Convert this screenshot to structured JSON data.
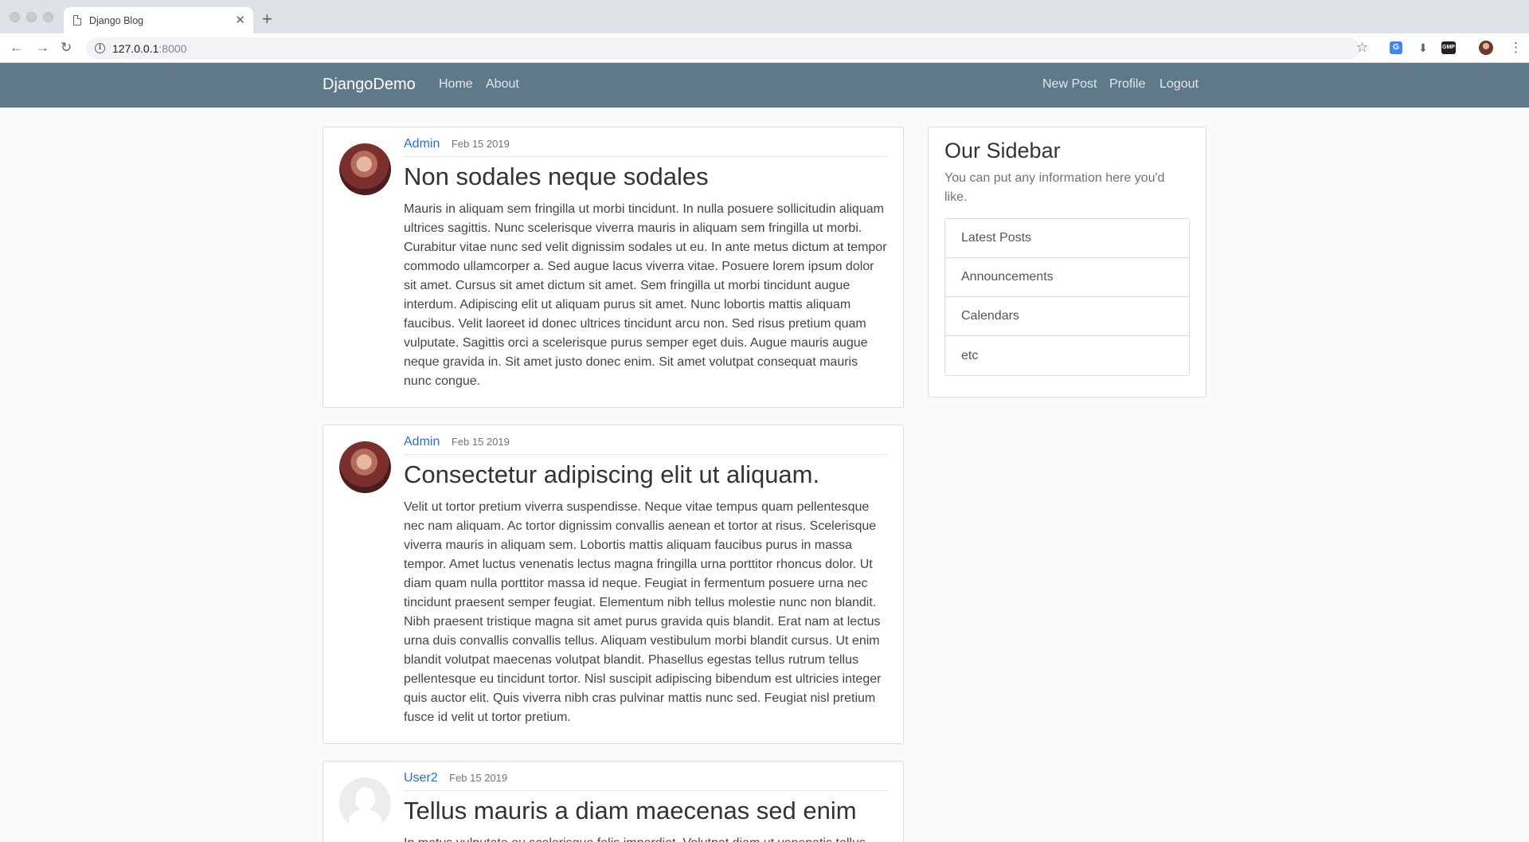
{
  "browser": {
    "tab_title": "Django Blog",
    "url_host": "127.0.0.1",
    "url_port": ":8000"
  },
  "navbar": {
    "brand": "DjangoDemo",
    "left_links": [
      "Home",
      "About"
    ],
    "right_links": [
      "New Post",
      "Profile",
      "Logout"
    ],
    "color": "#5f788a"
  },
  "posts": [
    {
      "author": "Admin",
      "date": "Feb 15 2019",
      "title": "Non sodales neque sodales",
      "content": "Mauris in aliquam sem fringilla ut morbi tincidunt. In nulla posuere sollicitudin aliquam ultrices sagittis. Nunc scelerisque viverra mauris in aliquam sem fringilla ut morbi. Curabitur vitae nunc sed velit dignissim sodales ut eu. In ante metus dictum at tempor commodo ullamcorper a. Sed augue lacus viverra vitae. Posuere lorem ipsum dolor sit amet. Cursus sit amet dictum sit amet. Sem fringilla ut morbi tincidunt augue interdum. Adipiscing elit ut aliquam purus sit amet. Nunc lobortis mattis aliquam faucibus. Velit laoreet id donec ultrices tincidunt arcu non. Sed risus pretium quam vulputate. Sagittis orci a scelerisque purus semper eget duis. Augue mauris augue neque gravida in. Sit amet justo donec enim. Sit amet volutpat consequat mauris nunc congue."
    },
    {
      "author": "Admin",
      "date": "Feb 15 2019",
      "title": "Consectetur adipiscing elit ut aliquam.",
      "content": "Velit ut tortor pretium viverra suspendisse. Neque vitae tempus quam pellentesque nec nam aliquam. Ac tortor dignissim convallis aenean et tortor at risus. Scelerisque viverra mauris in aliquam sem. Lobortis mattis aliquam faucibus purus in massa tempor. Amet luctus venenatis lectus magna fringilla urna porttitor rhoncus dolor. Ut diam quam nulla porttitor massa id neque. Feugiat in fermentum posuere urna nec tincidunt praesent semper feugiat. Elementum nibh tellus molestie nunc non blandit. Nibh praesent tristique magna sit amet purus gravida quis blandit. Erat nam at lectus urna duis convallis convallis tellus. Aliquam vestibulum morbi blandit cursus. Ut enim blandit volutpat maecenas volutpat blandit. Phasellus egestas tellus rutrum tellus pellentesque eu tincidunt tortor. Nisl suscipit adipiscing bibendum est ultricies integer quis auctor elit. Quis viverra nibh cras pulvinar mattis nunc sed. Feugiat nisl pretium fusce id velit ut tortor pretium."
    },
    {
      "author": "User2",
      "date": "Feb 15 2019",
      "title": "Tellus mauris a diam maecenas sed enim",
      "content": "In metus vulputate eu scelerisque felis imperdiet. Volutpat diam ut venenatis tellus"
    }
  ],
  "sidebar": {
    "title": "Our Sidebar",
    "description": "You can put any information here you'd like.",
    "items": [
      "Latest Posts",
      "Announcements",
      "Calendars",
      "etc"
    ]
  }
}
